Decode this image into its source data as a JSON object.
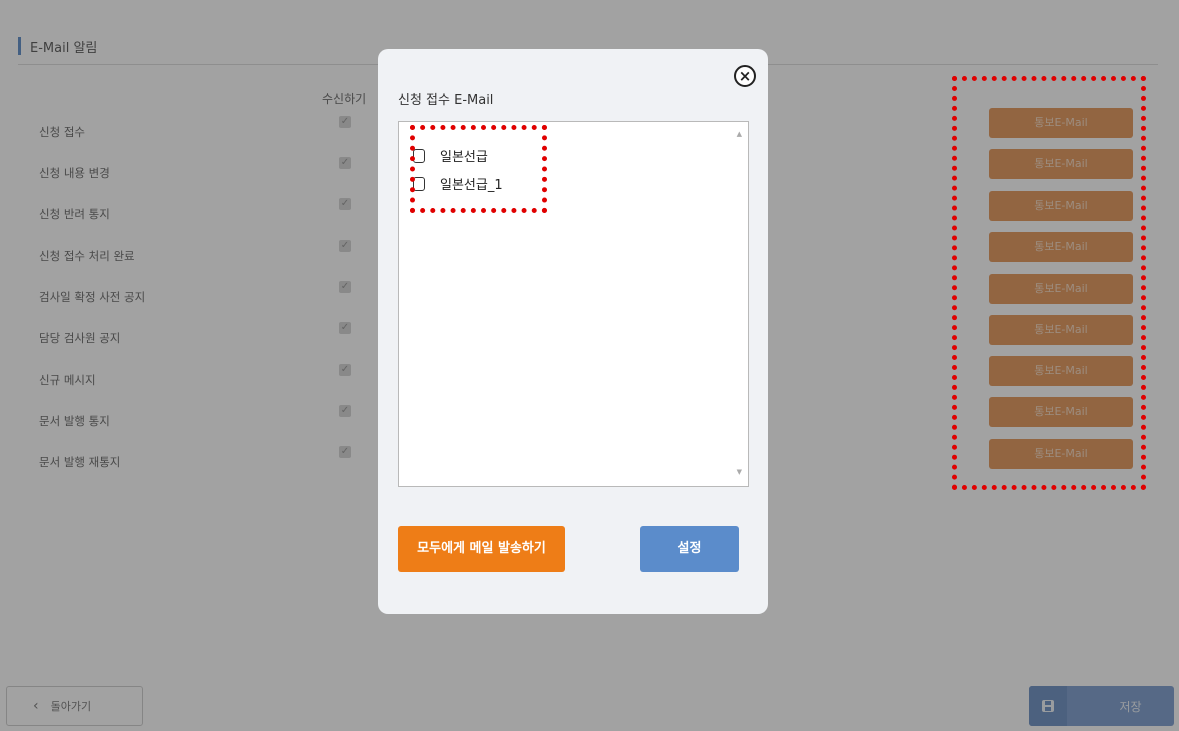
{
  "section": {
    "title": "E-Mail 알림"
  },
  "column_header": "수신하기",
  "rows": [
    {
      "label": "신청 접수",
      "checked": true,
      "notice_label": "통보E-Mail"
    },
    {
      "label": "신청 내용 변경",
      "checked": true,
      "notice_label": "통보E-Mail"
    },
    {
      "label": "신청 반려 통지",
      "checked": true,
      "notice_label": "통보E-Mail"
    },
    {
      "label": "신청 접수 처리 완료",
      "checked": true,
      "notice_label": "통보E-Mail"
    },
    {
      "label": "검사일 확정 사전 공지",
      "checked": true,
      "notice_label": "통보E-Mail"
    },
    {
      "label": "담당 검사원 공지",
      "checked": true,
      "notice_label": "통보E-Mail"
    },
    {
      "label": "신규 메시지",
      "checked": true,
      "notice_label": "통보E-Mail"
    },
    {
      "label": "문서 발행 통지",
      "checked": true,
      "notice_label": "통보E-Mail"
    },
    {
      "label": "문서 발행 재통지",
      "checked": true,
      "notice_label": "통보E-Mail"
    }
  ],
  "footer": {
    "back_label": "돌아가기",
    "save_label": "저장"
  },
  "modal": {
    "title": "신청 접수 E-Mail",
    "close_symbol": "×",
    "list_items": [
      {
        "label": "일본선급",
        "checked": false
      },
      {
        "label": "일본선급_1",
        "checked": false
      }
    ],
    "send_all_label": "모두에게 메일 발송하기",
    "set_label": "설정"
  },
  "colors": {
    "accent_orange": "#ee7d17",
    "accent_blue": "#5b8ccb",
    "annotation_red": "#e00000"
  }
}
